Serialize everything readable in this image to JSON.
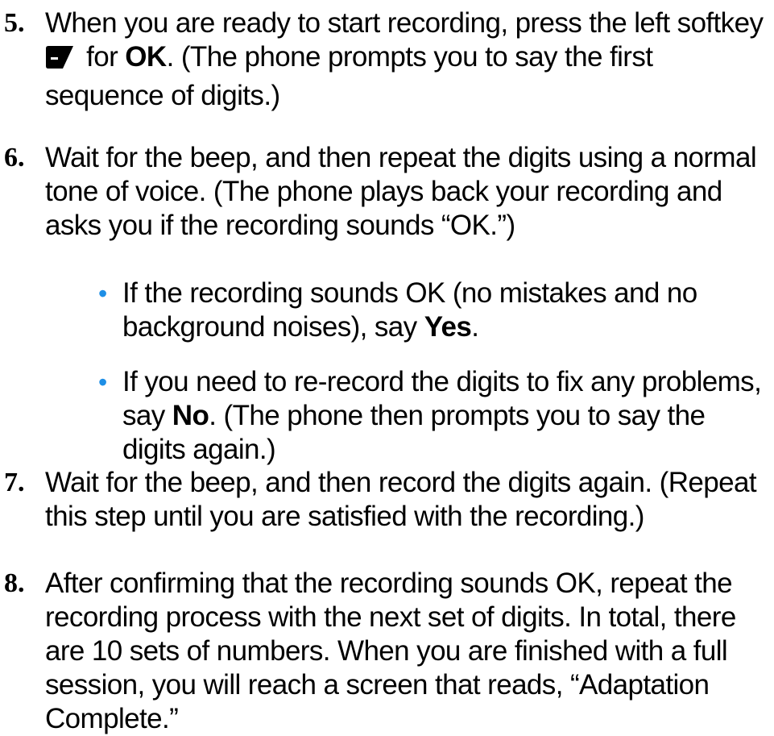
{
  "steps": [
    {
      "number": "5.",
      "text_before_icon": "When you are ready to start recording, press the left softkey",
      "icon": "left-softkey-icon",
      "text_after_icon_pre": " for ",
      "keyword": "OK",
      "text_after_keyword": ". (The phone prompts you to say the first sequence of digits.)"
    },
    {
      "number": "6.",
      "text": "Wait for the beep, and then repeat the digits using a normal tone of voice. (The phone plays back your recording and asks you if the recording sounds “OK.”)"
    },
    {
      "number": "7.",
      "text": "Wait for the beep, and then record the digits again. (Repeat this step until you are satisfied with the recording.)"
    },
    {
      "number": "8.",
      "text": "After confirming that the recording sounds OK, repeat the recording process with the next set of digits. In total, there are 10 sets of numbers. When you are finished with a full session, you will reach a screen that reads, “Adaptation Complete.”"
    }
  ],
  "bullets": [
    {
      "text_before": "If the recording sounds OK (no mistakes and no background noises), say ",
      "keyword": "Yes",
      "text_after": "."
    },
    {
      "text_before": "If you need to re-record the digits to fix any problems, say ",
      "keyword": "No",
      "text_after": ". (The phone then prompts you to say the digits again.)"
    }
  ],
  "colors": {
    "bullet": "#1e8fe6",
    "text": "#000000"
  }
}
